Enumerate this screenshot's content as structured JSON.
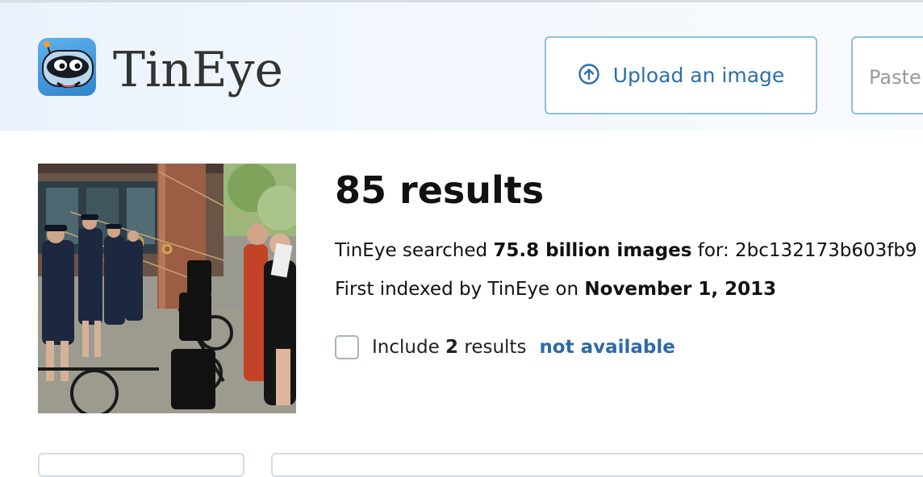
{
  "brand": {
    "name": "TinEye"
  },
  "header": {
    "upload_label": "Upload an image",
    "paste_placeholder": "Paste or enter image URL"
  },
  "results": {
    "title": "85 results",
    "searched_prefix": "TinEye searched ",
    "searched_count": "75.8 billion images",
    "searched_mid": " for: ",
    "image_hash": "2bc132173b603fb9",
    "indexed_prefix": "First indexed by TinEye on ",
    "indexed_date": "November 1, 2013",
    "include_prefix": "Include ",
    "include_count": "2",
    "include_mid": " results ",
    "include_link": "not available"
  },
  "colors": {
    "accent": "#2f6aa5",
    "border": "#8fbfd8",
    "header_bg": "#eaf2fb"
  },
  "icons": {
    "upload": "arrow-up-circle-icon",
    "logo": "tineye-robot-icon"
  }
}
